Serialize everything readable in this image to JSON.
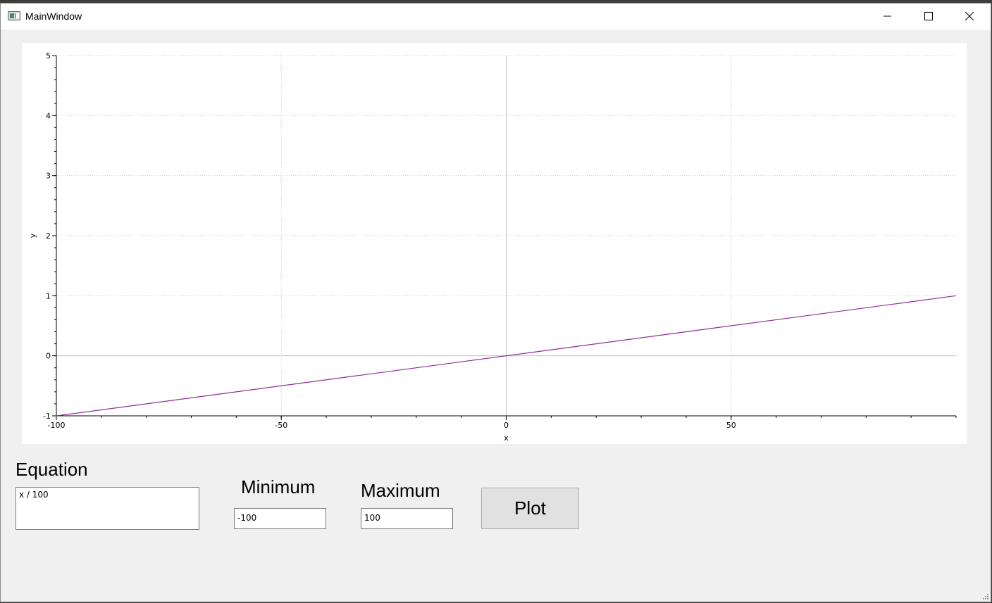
{
  "window": {
    "title": "MainWindow",
    "minimize": "minimize-icon",
    "maximize": "maximize-icon",
    "close": "close-icon"
  },
  "controls": {
    "equation_label": "Equation",
    "equation_value": "x / 100",
    "minimum_label": "Minimum",
    "minimum_value": "-100",
    "maximum_label": "Maximum",
    "maximum_value": "100",
    "plot_button": "Plot"
  },
  "colors": {
    "curve": "#8b2f94",
    "grid": "#c8c8c8",
    "axis_zero": "#c0c0c0"
  },
  "chart_data": {
    "type": "line",
    "title": "",
    "xlabel": "x",
    "ylabel": "y",
    "xlim": [
      -100,
      100
    ],
    "ylim": [
      -1,
      5
    ],
    "x_ticks": [
      -100,
      -50,
      0,
      50
    ],
    "y_ticks": [
      -1,
      0,
      1,
      2,
      3,
      4,
      5
    ],
    "grid": true,
    "series": [
      {
        "x": [
          -100,
          100
        ],
        "y": [
          -1,
          1
        ]
      }
    ]
  }
}
